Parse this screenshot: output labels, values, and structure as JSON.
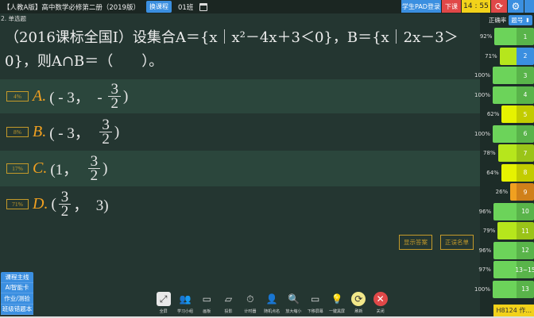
{
  "topbar": {
    "title": "【人教A版】高中数学必修第二册（2019版）",
    "switch_course": "换课程",
    "class_name": "01班",
    "pad_login": "学生PAD登录",
    "end_class": "下课",
    "time": "14 : 55"
  },
  "question": {
    "type": "2.  单选题",
    "stem": "（2016课标全国Ⅰ）设集合A＝{x｜x²－4x＋3＜0}，B＝{x｜2x－3＞0}，则A∩B＝（　　）。",
    "options": [
      {
        "pct": "4%",
        "letter": "A.",
        "pre": "( - 3，  - ",
        "num": "3",
        "den": "2",
        "post": ")"
      },
      {
        "pct": "8%",
        "letter": "B.",
        "pre": "( - 3，  ",
        "num": "3",
        "den": "2",
        "post": ")"
      },
      {
        "pct": "17%",
        "letter": "C.",
        "pre": "(1，  ",
        "num": "3",
        "den": "2",
        "post": ")"
      },
      {
        "pct": "71%",
        "letter": "D.",
        "pre": "(",
        "num": "3",
        "den": "2",
        "post": "，  3)"
      }
    ]
  },
  "actions": {
    "show_answer": "显示答案",
    "correct_list": "正误名单"
  },
  "panel": {
    "header": "正确率",
    "sort": "题号 ⬍",
    "items": [
      {
        "label": "1",
        "pct": "92%",
        "value": 92,
        "color": "#6cd35a",
        "numcolor": "#59b44a"
      },
      {
        "label": "2",
        "pct": "71%",
        "value": 71,
        "color": "#b6e61c",
        "numcolor": "#3b8fe0"
      },
      {
        "label": "3",
        "pct": "100%",
        "value": 100,
        "color": "#6cd35a",
        "numcolor": "#59b44a"
      },
      {
        "label": "4",
        "pct": "100%",
        "value": 100,
        "color": "#6cd35a",
        "numcolor": "#59b44a"
      },
      {
        "label": "5",
        "pct": "62%",
        "value": 62,
        "color": "#e6f200",
        "numcolor": "#c2cc00"
      },
      {
        "label": "6",
        "pct": "100%",
        "value": 100,
        "color": "#6cd35a",
        "numcolor": "#59b44a"
      },
      {
        "label": "7",
        "pct": "78%",
        "value": 78,
        "color": "#b6e61c",
        "numcolor": "#9ac418"
      },
      {
        "label": "8",
        "pct": "64%",
        "value": 64,
        "color": "#e6f200",
        "numcolor": "#c2cc00"
      },
      {
        "label": "9",
        "pct": "26%",
        "value": 26,
        "color": "#f0a020",
        "numcolor": "#d0801a"
      },
      {
        "label": "10",
        "pct": "96%",
        "value": 96,
        "color": "#6cd35a",
        "numcolor": "#59b44a"
      },
      {
        "label": "11",
        "pct": "79%",
        "value": 79,
        "color": "#b6e61c",
        "numcolor": "#9ac418"
      },
      {
        "label": "12",
        "pct": "96%",
        "value": 96,
        "color": "#6cd35a",
        "numcolor": "#59b44a"
      },
      {
        "label": "13~15",
        "pct": "97%",
        "value": 97,
        "color": "#6cd35a",
        "numcolor": "#59b44a"
      },
      {
        "label": "13",
        "pct": "100%",
        "value": 100,
        "color": "#6cd35a",
        "numcolor": "#59b44a"
      }
    ]
  },
  "leftnav": [
    "课程主线",
    "AI智能卡",
    "作业/测验",
    "班级错题本"
  ],
  "tools": [
    {
      "label": "全屏",
      "icon": "⤢"
    },
    {
      "label": "学习小组",
      "icon": "👥"
    },
    {
      "label": "画板",
      "icon": "▭"
    },
    {
      "label": "投影",
      "icon": "▱"
    },
    {
      "label": "计时器",
      "icon": "⏱"
    },
    {
      "label": "随机点名",
      "icon": "👤"
    },
    {
      "label": "放大缩小",
      "icon": "🔍"
    },
    {
      "label": "下移屏幕",
      "icon": "▭"
    },
    {
      "label": "一键黑屏",
      "icon": "💡"
    },
    {
      "label": "刷新",
      "icon": "⟳"
    },
    {
      "label": "关闭",
      "icon": "✕"
    }
  ],
  "homework": "H8124 作..."
}
